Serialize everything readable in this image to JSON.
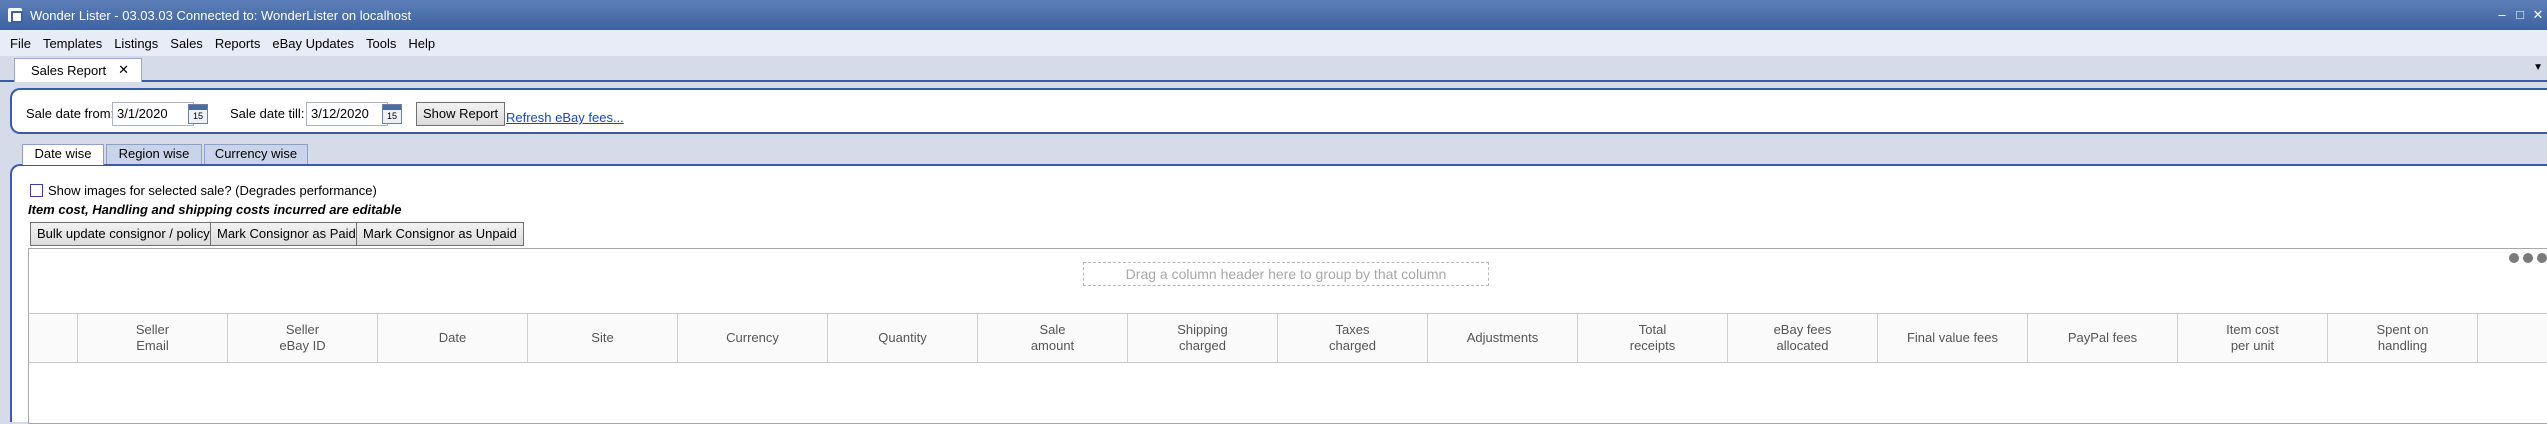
{
  "window": {
    "title": "Wonder Lister - 03.03.03 Connected to: WonderLister on localhost",
    "controls": [
      "–",
      "□",
      "✕"
    ]
  },
  "menu": [
    "File",
    "Templates",
    "Listings",
    "Sales",
    "Reports",
    "eBay Updates",
    "Tools",
    "Help"
  ],
  "doc_tab": {
    "label": "Sales Report",
    "close": "✕",
    "dropdown": "▼"
  },
  "filters": {
    "from_label": "Sale date from:",
    "from_value": "3/1/2020",
    "till_label": "Sale date till:",
    "till_value": "3/12/2020",
    "calendar_glyph": "15",
    "show_report": "Show Report",
    "refresh_link": "Refresh eBay fees..."
  },
  "inner_tabs": [
    "Date wise",
    "Region wise",
    "Currency wise"
  ],
  "options": {
    "show_images_label": "Show images for selected sale? (Degrades performance)",
    "note": "Item cost, Handling and shipping costs incurred are editable"
  },
  "actions": [
    "Bulk update consignor / policy",
    "Mark Consignor as Paid",
    "Mark Consignor as Unpaid"
  ],
  "grid": {
    "group_hint": "Drag a column header here to group by that column",
    "columns": [
      "",
      "Seller\nEmail",
      "Seller\neBay ID",
      "Date",
      "Site",
      "Currency",
      "Quantity",
      "Sale\namount",
      "Shipping\ncharged",
      "Taxes\ncharged",
      "Adjustments",
      "Total\nreceipts",
      "eBay fees\nallocated",
      "Final value fees",
      "PayPal fees",
      "Item cost\nper unit",
      "Spent on\nhandling",
      ""
    ]
  }
}
